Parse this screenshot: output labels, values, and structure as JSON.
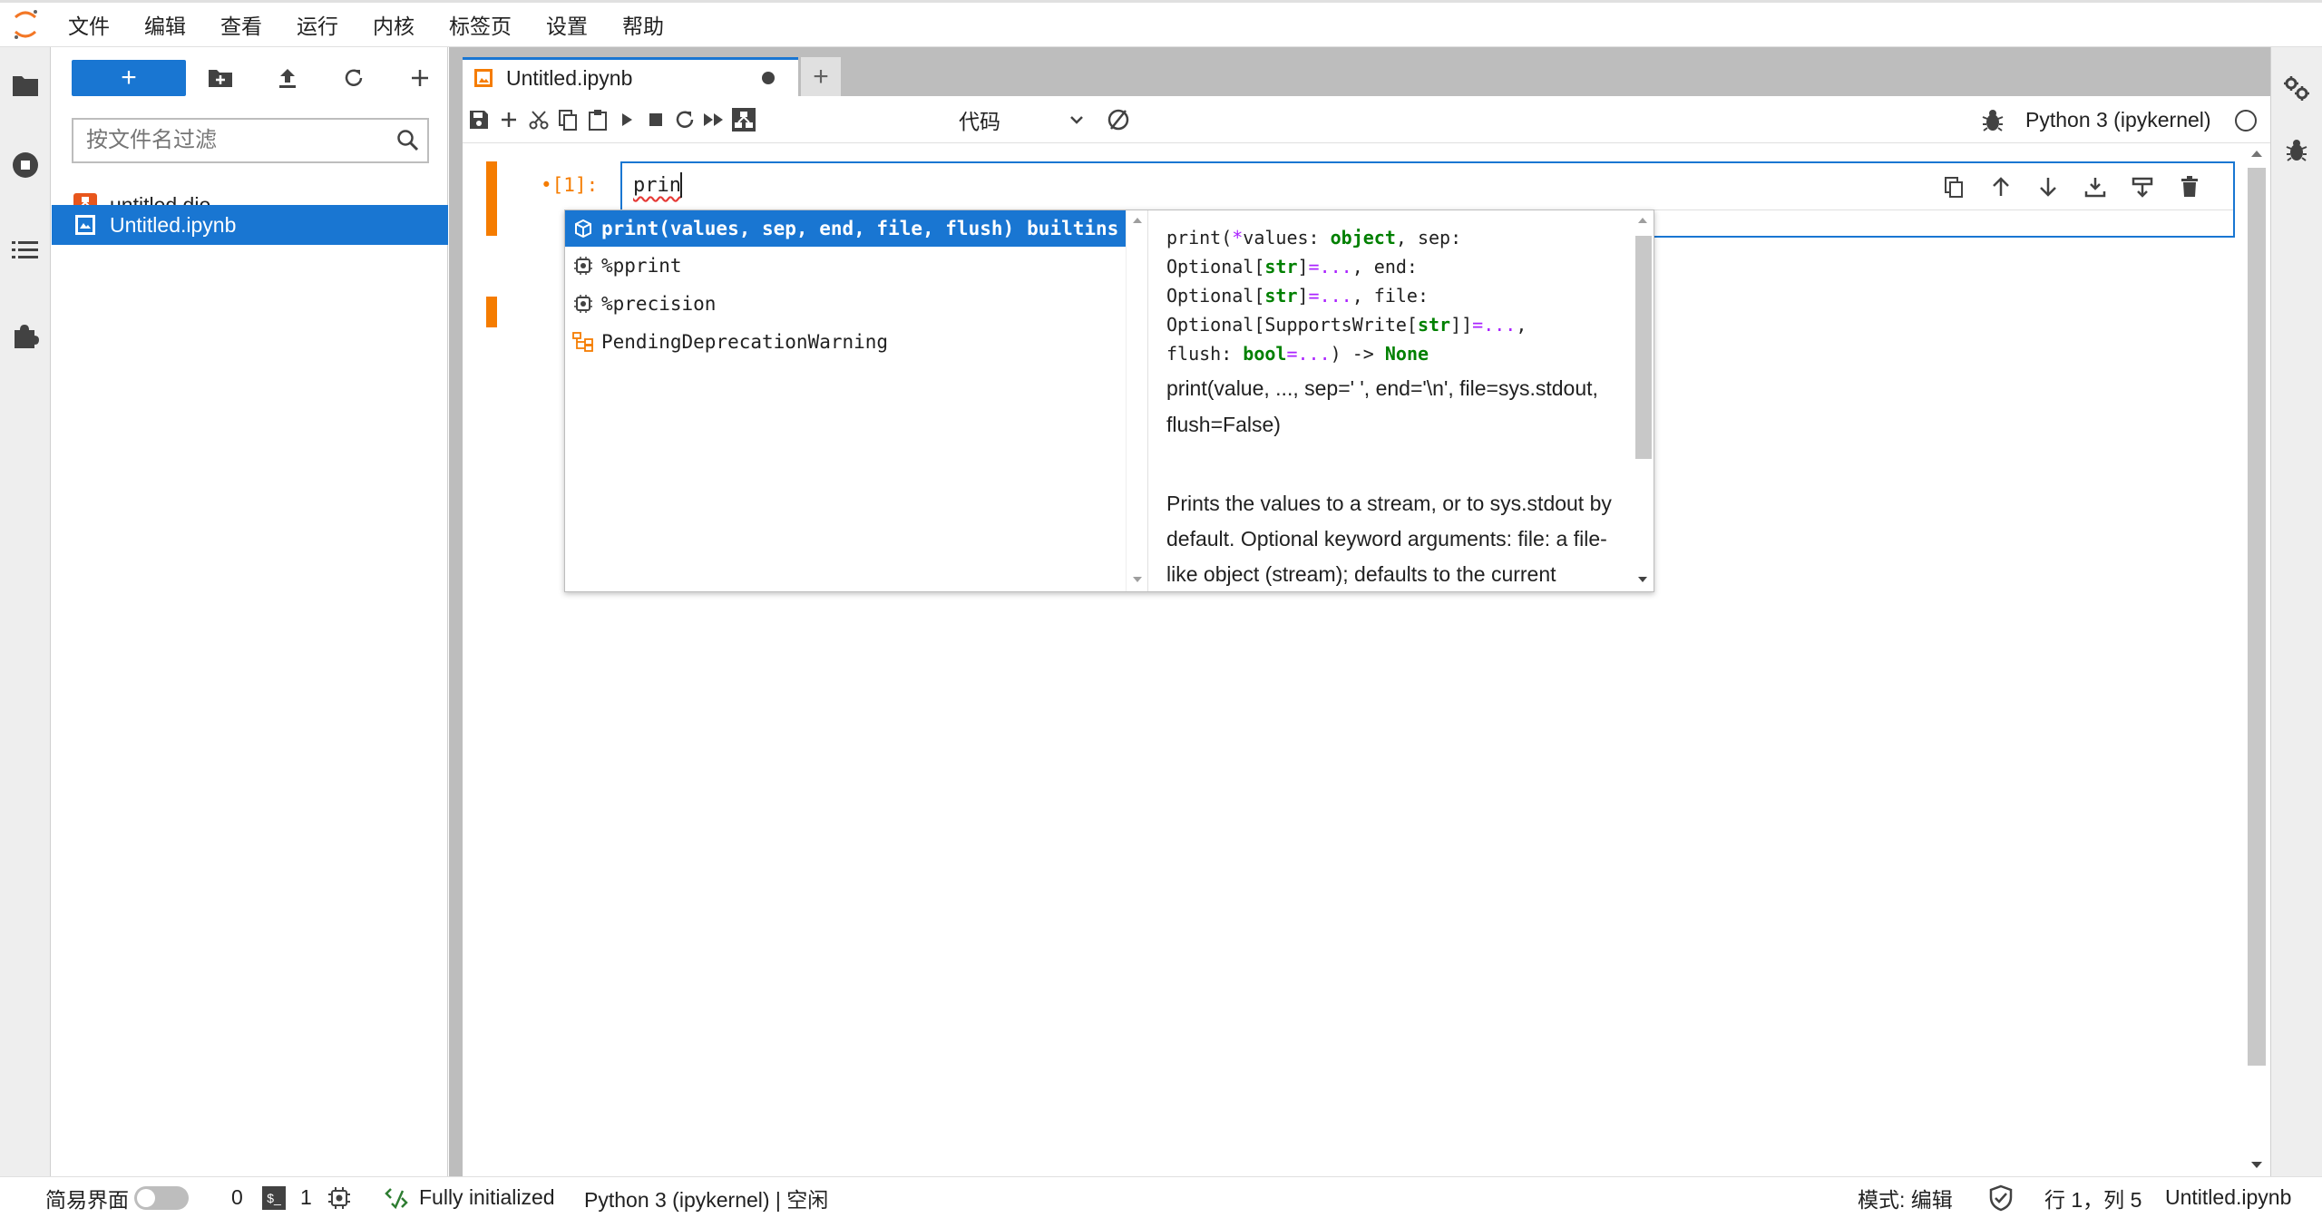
{
  "menu": [
    "文件",
    "编辑",
    "查看",
    "运行",
    "内核",
    "标签页",
    "设置",
    "帮助"
  ],
  "filebrowser": {
    "new_button": "+",
    "filter_placeholder": "按文件名过滤",
    "files": [
      {
        "name": "untitled.dio",
        "icon": "drawio-icon"
      },
      {
        "name": "Untitled.ipynb",
        "icon": "notebook-icon",
        "selected": true
      }
    ]
  },
  "tabs": {
    "doc_tab": "Untitled.ipynb",
    "add": "+"
  },
  "toolbar": {
    "cell_type": "代码",
    "kernel": "Python 3 (ipykernel)"
  },
  "cell": {
    "prompt": "•[1]:",
    "code": "prin"
  },
  "completer": {
    "items": [
      {
        "label": "print(values, sep, end, file, flush)",
        "type": "builtins",
        "icon": "function-icon",
        "active": true
      },
      {
        "label": "%pprint",
        "type": "",
        "icon": "magic-icon"
      },
      {
        "label": "%precision",
        "type": "",
        "icon": "magic-icon"
      },
      {
        "label": "PendingDeprecationWarning",
        "type": "",
        "icon": "class-icon"
      }
    ],
    "doc_signature_lines": [
      "print(*values: object, sep:",
      "Optional[str]=..., end:",
      "Optional[str]=..., file:",
      "Optional[SupportsWrite[str]]=...,",
      "flush: bool=...) -> None"
    ],
    "doc_p1": "print(value, ..., sep=' ', end='\\n', file=sys.stdout, flush=False)",
    "doc_p2": "Prints the values to a stream, or to sys.stdout by default. Optional keyword arguments: file:  a file-like object (stream); defaults to the current sys.stdout. sep:"
  },
  "status": {
    "simple_mode": "简易界面",
    "terminals": "0",
    "kernels": "1",
    "lsp": "Fully initialized",
    "kernel_status": "Python 3 (ipykernel) | 空闲",
    "mode": "模式: 编辑",
    "position": "行 1，列 5",
    "filename": "Untitled.ipynb"
  },
  "colors": {
    "accent": "#1976d2",
    "cell_active": "#f57c00"
  }
}
